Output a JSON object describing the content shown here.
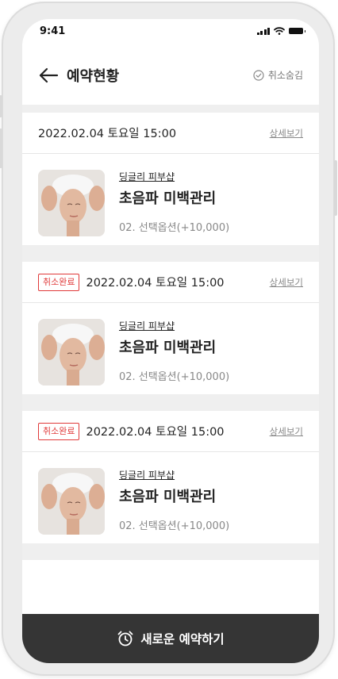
{
  "status_bar": {
    "time": "9:41"
  },
  "header": {
    "title": "예약현황",
    "hide_cancelled_label": "취소숨김",
    "icons": {
      "back": "arrow-left-icon",
      "hide_cancelled": "check-circle-icon"
    }
  },
  "reservations": [
    {
      "cancel_badge": "",
      "datetime": "2022.02.04 토요일 15:00",
      "detail_label": "상세보기",
      "shop_name": "딩글리 피부샵",
      "service_name": "초음파 미백관리",
      "option": "02. 선택옵션(+10,000)"
    },
    {
      "cancel_badge": "취소완료",
      "datetime": "2022.02.04 토요일 15:00",
      "detail_label": "상세보기",
      "shop_name": "딩글리 피부샵",
      "service_name": "초음파 미백관리",
      "option": "02. 선택옵션(+10,000)"
    },
    {
      "cancel_badge": "취소완료",
      "datetime": "2022.02.04 토요일 15:00",
      "detail_label": "상세보기",
      "shop_name": "딩글리 피부샵",
      "service_name": "초음파 미백관리",
      "option": "02. 선택옵션(+10,000)"
    }
  ],
  "bottom_action": {
    "label": "새로운 예약하기",
    "icon": "alarm-clock-icon"
  },
  "colors": {
    "cancel_badge": "#e03a3a",
    "bottom_bar": "#353535",
    "background": "#efefef"
  }
}
